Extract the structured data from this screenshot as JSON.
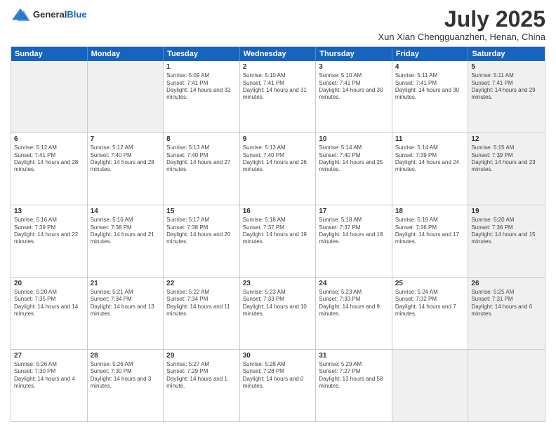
{
  "header": {
    "logo_general": "General",
    "logo_blue": "Blue",
    "month": "July 2025",
    "location": "Xun Xian Chengguanzhen, Henan, China"
  },
  "days_of_week": [
    "Sunday",
    "Monday",
    "Tuesday",
    "Wednesday",
    "Thursday",
    "Friday",
    "Saturday"
  ],
  "weeks": [
    [
      {
        "day": "",
        "sunrise": "",
        "sunset": "",
        "daylight": "",
        "shaded": true
      },
      {
        "day": "",
        "sunrise": "",
        "sunset": "",
        "daylight": "",
        "shaded": true
      },
      {
        "day": "1",
        "sunrise": "Sunrise: 5:09 AM",
        "sunset": "Sunset: 7:41 PM",
        "daylight": "Daylight: 14 hours and 32 minutes.",
        "shaded": false
      },
      {
        "day": "2",
        "sunrise": "Sunrise: 5:10 AM",
        "sunset": "Sunset: 7:41 PM",
        "daylight": "Daylight: 14 hours and 31 minutes.",
        "shaded": false
      },
      {
        "day": "3",
        "sunrise": "Sunrise: 5:10 AM",
        "sunset": "Sunset: 7:41 PM",
        "daylight": "Daylight: 14 hours and 30 minutes.",
        "shaded": false
      },
      {
        "day": "4",
        "sunrise": "Sunrise: 5:11 AM",
        "sunset": "Sunset: 7:41 PM",
        "daylight": "Daylight: 14 hours and 30 minutes.",
        "shaded": false
      },
      {
        "day": "5",
        "sunrise": "Sunrise: 5:11 AM",
        "sunset": "Sunset: 7:41 PM",
        "daylight": "Daylight: 14 hours and 29 minutes.",
        "shaded": true
      }
    ],
    [
      {
        "day": "6",
        "sunrise": "Sunrise: 5:12 AM",
        "sunset": "Sunset: 7:41 PM",
        "daylight": "Daylight: 14 hours and 28 minutes.",
        "shaded": false
      },
      {
        "day": "7",
        "sunrise": "Sunrise: 5:12 AM",
        "sunset": "Sunset: 7:40 PM",
        "daylight": "Daylight: 14 hours and 28 minutes.",
        "shaded": false
      },
      {
        "day": "8",
        "sunrise": "Sunrise: 5:13 AM",
        "sunset": "Sunset: 7:40 PM",
        "daylight": "Daylight: 14 hours and 27 minutes.",
        "shaded": false
      },
      {
        "day": "9",
        "sunrise": "Sunrise: 5:13 AM",
        "sunset": "Sunset: 7:40 PM",
        "daylight": "Daylight: 14 hours and 26 minutes.",
        "shaded": false
      },
      {
        "day": "10",
        "sunrise": "Sunrise: 5:14 AM",
        "sunset": "Sunset: 7:40 PM",
        "daylight": "Daylight: 14 hours and 25 minutes.",
        "shaded": false
      },
      {
        "day": "11",
        "sunrise": "Sunrise: 5:14 AM",
        "sunset": "Sunset: 7:39 PM",
        "daylight": "Daylight: 14 hours and 24 minutes.",
        "shaded": false
      },
      {
        "day": "12",
        "sunrise": "Sunrise: 5:15 AM",
        "sunset": "Sunset: 7:39 PM",
        "daylight": "Daylight: 14 hours and 23 minutes.",
        "shaded": true
      }
    ],
    [
      {
        "day": "13",
        "sunrise": "Sunrise: 5:16 AM",
        "sunset": "Sunset: 7:39 PM",
        "daylight": "Daylight: 14 hours and 22 minutes.",
        "shaded": false
      },
      {
        "day": "14",
        "sunrise": "Sunrise: 5:16 AM",
        "sunset": "Sunset: 7:38 PM",
        "daylight": "Daylight: 14 hours and 21 minutes.",
        "shaded": false
      },
      {
        "day": "15",
        "sunrise": "Sunrise: 5:17 AM",
        "sunset": "Sunset: 7:38 PM",
        "daylight": "Daylight: 14 hours and 20 minutes.",
        "shaded": false
      },
      {
        "day": "16",
        "sunrise": "Sunrise: 5:18 AM",
        "sunset": "Sunset: 7:37 PM",
        "daylight": "Daylight: 14 hours and 19 minutes.",
        "shaded": false
      },
      {
        "day": "17",
        "sunrise": "Sunrise: 5:18 AM",
        "sunset": "Sunset: 7:37 PM",
        "daylight": "Daylight: 14 hours and 18 minutes.",
        "shaded": false
      },
      {
        "day": "18",
        "sunrise": "Sunrise: 5:19 AM",
        "sunset": "Sunset: 7:36 PM",
        "daylight": "Daylight: 14 hours and 17 minutes.",
        "shaded": false
      },
      {
        "day": "19",
        "sunrise": "Sunrise: 5:20 AM",
        "sunset": "Sunset: 7:36 PM",
        "daylight": "Daylight: 14 hours and 15 minutes.",
        "shaded": true
      }
    ],
    [
      {
        "day": "20",
        "sunrise": "Sunrise: 5:20 AM",
        "sunset": "Sunset: 7:35 PM",
        "daylight": "Daylight: 14 hours and 14 minutes.",
        "shaded": false
      },
      {
        "day": "21",
        "sunrise": "Sunrise: 5:21 AM",
        "sunset": "Sunset: 7:34 PM",
        "daylight": "Daylight: 14 hours and 13 minutes.",
        "shaded": false
      },
      {
        "day": "22",
        "sunrise": "Sunrise: 5:22 AM",
        "sunset": "Sunset: 7:34 PM",
        "daylight": "Daylight: 14 hours and 11 minutes.",
        "shaded": false
      },
      {
        "day": "23",
        "sunrise": "Sunrise: 5:23 AM",
        "sunset": "Sunset: 7:33 PM",
        "daylight": "Daylight: 14 hours and 10 minutes.",
        "shaded": false
      },
      {
        "day": "24",
        "sunrise": "Sunrise: 5:23 AM",
        "sunset": "Sunset: 7:33 PM",
        "daylight": "Daylight: 14 hours and 9 minutes.",
        "shaded": false
      },
      {
        "day": "25",
        "sunrise": "Sunrise: 5:24 AM",
        "sunset": "Sunset: 7:32 PM",
        "daylight": "Daylight: 14 hours and 7 minutes.",
        "shaded": false
      },
      {
        "day": "26",
        "sunrise": "Sunrise: 5:25 AM",
        "sunset": "Sunset: 7:31 PM",
        "daylight": "Daylight: 14 hours and 6 minutes.",
        "shaded": true
      }
    ],
    [
      {
        "day": "27",
        "sunrise": "Sunrise: 5:26 AM",
        "sunset": "Sunset: 7:30 PM",
        "daylight": "Daylight: 14 hours and 4 minutes.",
        "shaded": false
      },
      {
        "day": "28",
        "sunrise": "Sunrise: 5:26 AM",
        "sunset": "Sunset: 7:30 PM",
        "daylight": "Daylight: 14 hours and 3 minutes.",
        "shaded": false
      },
      {
        "day": "29",
        "sunrise": "Sunrise: 5:27 AM",
        "sunset": "Sunset: 7:29 PM",
        "daylight": "Daylight: 14 hours and 1 minute.",
        "shaded": false
      },
      {
        "day": "30",
        "sunrise": "Sunrise: 5:28 AM",
        "sunset": "Sunset: 7:28 PM",
        "daylight": "Daylight: 14 hours and 0 minutes.",
        "shaded": false
      },
      {
        "day": "31",
        "sunrise": "Sunrise: 5:29 AM",
        "sunset": "Sunset: 7:27 PM",
        "daylight": "Daylight: 13 hours and 58 minutes.",
        "shaded": false
      },
      {
        "day": "",
        "sunrise": "",
        "sunset": "",
        "daylight": "",
        "shaded": true
      },
      {
        "day": "",
        "sunrise": "",
        "sunset": "",
        "daylight": "",
        "shaded": true
      }
    ]
  ]
}
